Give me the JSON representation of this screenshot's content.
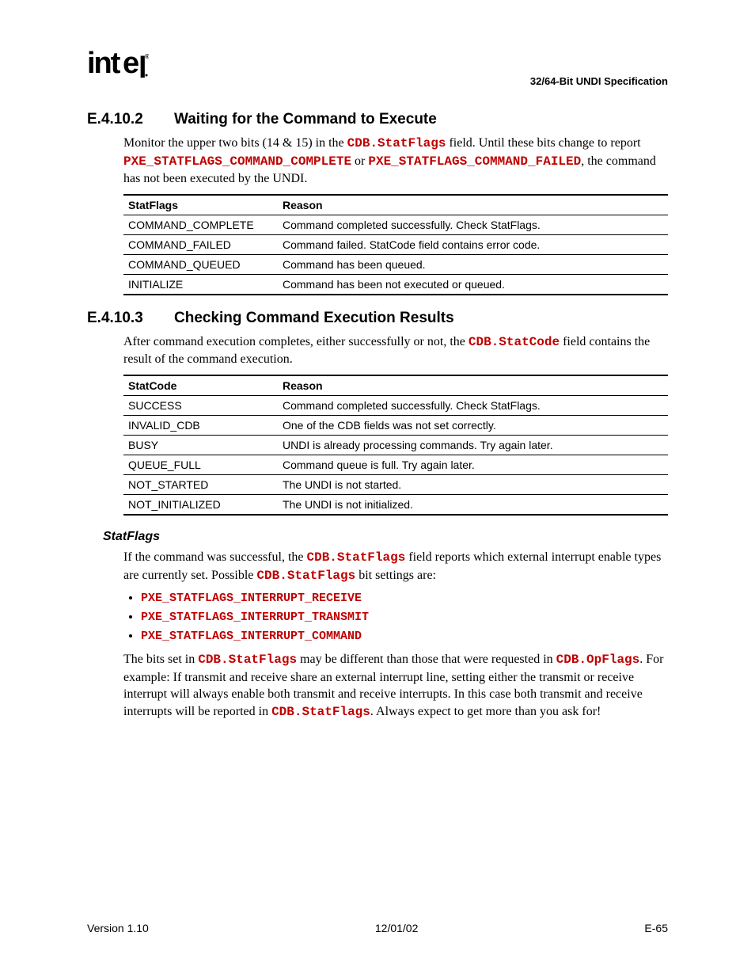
{
  "header": {
    "logo_text": "intel",
    "spec_title": "32/64-Bit UNDI Specification"
  },
  "section1": {
    "number": "E.4.10.2",
    "title": "Waiting for the Command to Execute",
    "para_pre": "Monitor the upper two bits (14 & 15) in the ",
    "code1": "CDB.StatFlags",
    "para_mid1": " field.  Until these bits change to report ",
    "code2": "PXE_STATFLAGS_COMMAND_COMPLETE",
    "para_mid2": " or ",
    "code3": "PXE_STATFLAGS_COMMAND_FAILED",
    "para_post": ", the command has not been executed by the UNDI.",
    "table": {
      "headers": [
        "StatFlags",
        "Reason"
      ],
      "rows": [
        [
          "COMMAND_COMPLETE",
          "Command completed successfully.  Check StatFlags."
        ],
        [
          "COMMAND_FAILED",
          "Command failed.  StatCode field contains error code."
        ],
        [
          "COMMAND_QUEUED",
          "Command has been queued."
        ],
        [
          "INITIALIZE",
          "Command has been not executed or queued."
        ]
      ]
    }
  },
  "section2": {
    "number": "E.4.10.3",
    "title": "Checking Command Execution Results",
    "para_pre": "After command execution completes, either successfully or not, the ",
    "code1": "CDB.StatCode",
    "para_post": " field contains the result of the command execution.",
    "table": {
      "headers": [
        "StatCode",
        "Reason"
      ],
      "rows": [
        [
          "SUCCESS",
          "Command completed successfully.  Check StatFlags."
        ],
        [
          "INVALID_CDB",
          "One of the CDB fields was not set correctly."
        ],
        [
          "BUSY",
          "UNDI is already processing commands.  Try again later."
        ],
        [
          "QUEUE_FULL",
          "Command queue is full.  Try again later."
        ],
        [
          "NOT_STARTED",
          "The UNDI is not started."
        ],
        [
          "NOT_INITIALIZED",
          "The UNDI is not initialized."
        ]
      ]
    }
  },
  "subsection": {
    "heading": "StatFlags",
    "para1_pre": "If the command was successful, the ",
    "para1_code1": "CDB.StatFlags",
    "para1_mid": " field reports which external interrupt enable types are currently set.  Possible ",
    "para1_code2": "CDB.StatFlags",
    "para1_post": " bit settings are:",
    "bullets": [
      "PXE_STATFLAGS_INTERRUPT_RECEIVE",
      "PXE_STATFLAGS_INTERRUPT_TRANSMIT",
      "PXE_STATFLAGS_INTERRUPT_COMMAND"
    ],
    "para2_pre": "The bits set in ",
    "para2_code1": "CDB.StatFlags",
    "para2_mid1": " may be different than those that were requested in ",
    "para2_code2": "CDB.OpFlags",
    "para2_mid2": ".  For example:  If transmit and receive share an external interrupt line, setting either the transmit or receive interrupt will always enable both transmit and receive interrupts.  In this case both transmit and receive interrupts will be reported in ",
    "para2_code3": "CDB.StatFlags",
    "para2_post": ".  Always expect to get more than you ask for!"
  },
  "footer": {
    "left": "Version 1.10",
    "center": "12/01/02",
    "right": "E-65"
  }
}
